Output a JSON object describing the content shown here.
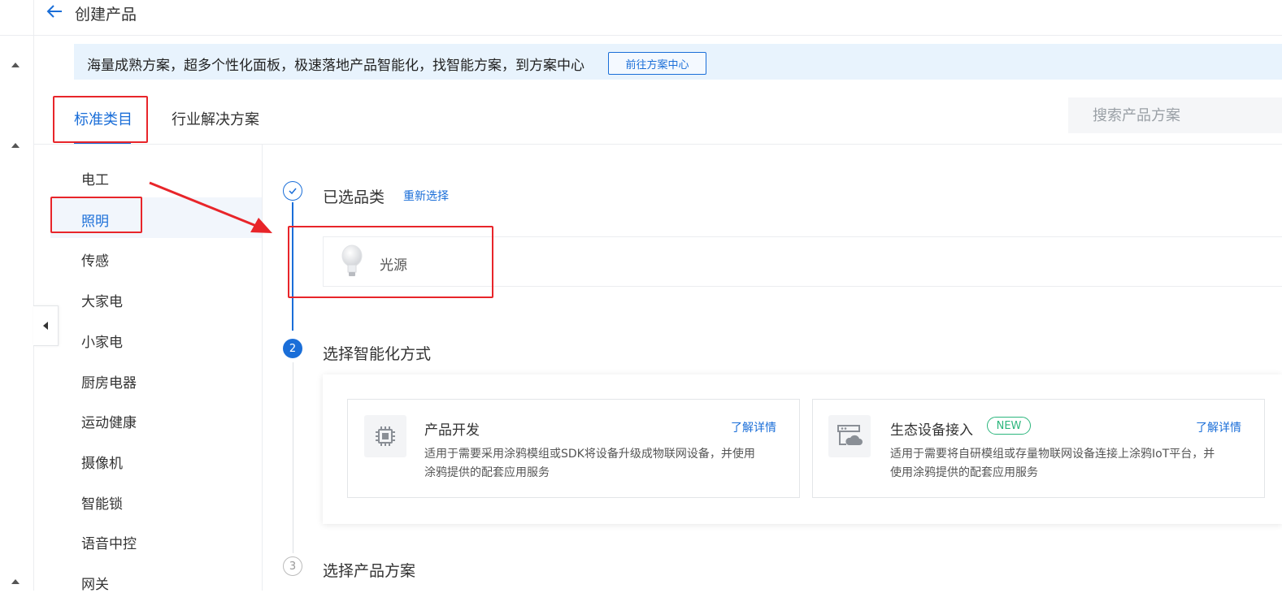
{
  "header": {
    "title": "创建产品"
  },
  "banner": {
    "text": "海量成熟方案，超多个性化面板，极速落地产品智能化，找智能方案，到方案中心",
    "button_label": "前往方案中心"
  },
  "tabs": [
    {
      "label": "标准类目",
      "active": true
    },
    {
      "label": "行业解决方案",
      "active": false
    }
  ],
  "search": {
    "placeholder": "搜索产品方案"
  },
  "categories": [
    {
      "label": "电工"
    },
    {
      "label": "照明",
      "active": true
    },
    {
      "label": "传感"
    },
    {
      "label": "大家电"
    },
    {
      "label": "小家电"
    },
    {
      "label": "厨房电器"
    },
    {
      "label": "运动健康"
    },
    {
      "label": "摄像机"
    },
    {
      "label": "智能锁"
    },
    {
      "label": "语音中控"
    },
    {
      "label": "网关"
    }
  ],
  "steps": {
    "step1": {
      "title": "已选品类",
      "action": "重新选择",
      "selected": "光源"
    },
    "step2": {
      "number": "2",
      "title": "选择智能化方式",
      "options": [
        {
          "title": "产品开发",
          "link": "了解详情",
          "desc_line1": "适用于需要采用涂鸦模组或SDK将设备升级成物联网设备，并使用",
          "desc_line2": "涂鸦提供的配套应用服务"
        },
        {
          "title": "生态设备接入",
          "badge": "NEW",
          "link": "了解详情",
          "desc_line1": "适用于需要将自研模组或存量物联网设备连接上涂鸦IoT平台，并",
          "desc_line2": "使用涂鸦提供的配套应用服务"
        }
      ]
    },
    "step3": {
      "number": "3",
      "title": "选择产品方案"
    }
  },
  "colors": {
    "primary": "#1a6ed8",
    "highlight": "#e8252a",
    "badge": "#2cb67d"
  }
}
